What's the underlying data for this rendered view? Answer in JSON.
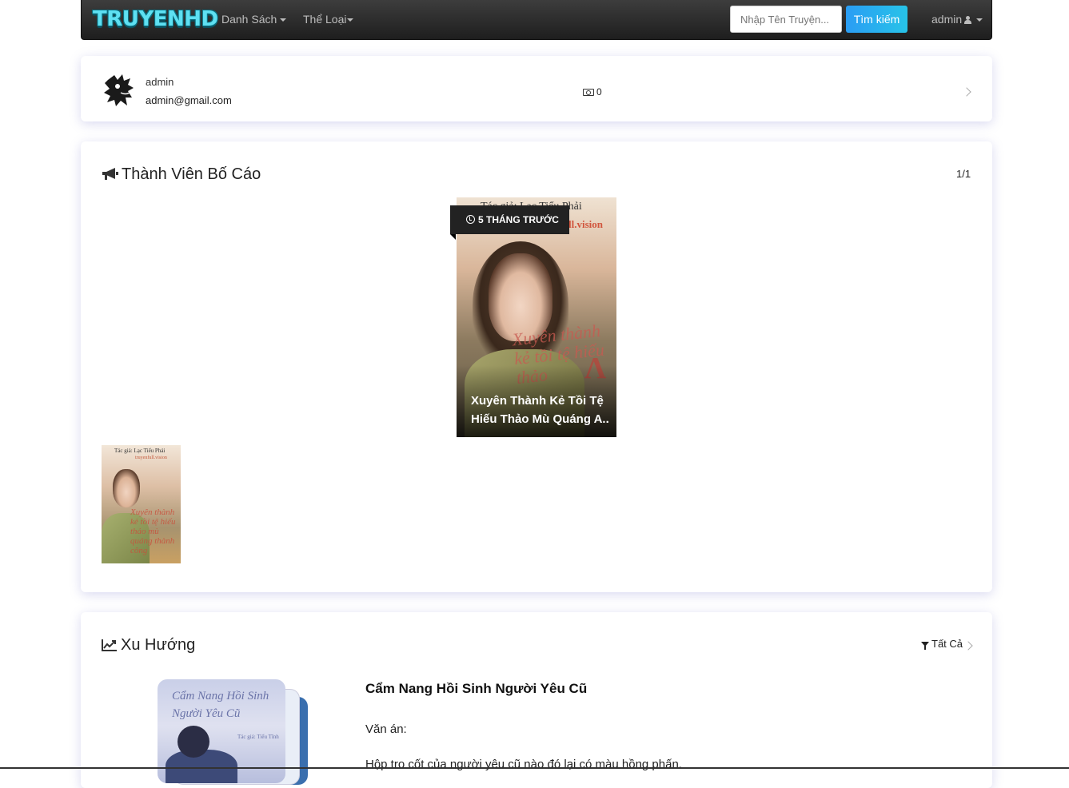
{
  "navbar": {
    "logo": "TRUYENHD",
    "menu_list": "Danh Sách",
    "menu_genre": "Thể Loại",
    "search_placeholder": "Nhập Tên Truyện...",
    "search_button": "Tìm kiếm",
    "user": "admin"
  },
  "profile": {
    "name": "admin",
    "email": "admin@gmail.com",
    "coins": "0"
  },
  "notices": {
    "title": "Thành Viên Bố Cáo",
    "page_indicator": "1/1",
    "featured": {
      "time": "5 THÁNG TRƯỚC",
      "title": "Xuyên Thành Kẻ Tồi Tệ Hiếu Thảo Mù Quáng A..",
      "cover_author": "Tác giả: Lạc Tiểu Phải",
      "cover_brand": "ll.vision",
      "cover_calligraphy": "Xuyên thành kẻ tồi tệ hiếu thảo"
    },
    "thumb": {
      "cover_author": "Tác giả: Lạc Tiểu Phải",
      "cover_brand": "truyenfull.vision",
      "cover_calligraphy": "Xuyên thành kẻ tồi tệ hiếu thảo mù quáng thành công"
    }
  },
  "trending": {
    "title": "Xu Hướng",
    "filter_label": "Tất Cả",
    "item": {
      "title": "Cẩm Nang Hồi Sinh Người Yêu Cũ",
      "label": "Văn án:",
      "description": "Hộp tro cốt của người yêu cũ nào đó lại có màu hồng phấn.",
      "cover_title": "Cẩm Nang Hồi Sinh Người Yêu Cũ",
      "cover_author": "Tác giả: Tiểu Tĩnh"
    }
  },
  "colors": {
    "accent": "#27c3e8",
    "navbar": "#2a2a2a"
  }
}
